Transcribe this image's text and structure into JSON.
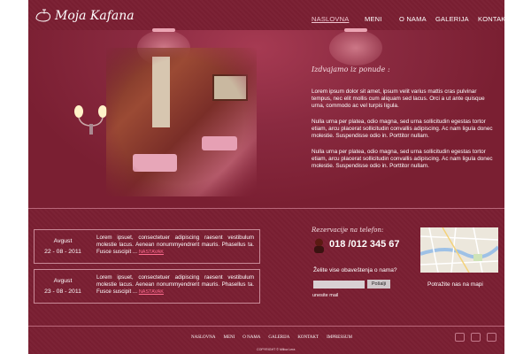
{
  "brand": {
    "logo_text": "Moja Kafana"
  },
  "nav": {
    "items": [
      {
        "label": "NASLOVNA",
        "active": true
      },
      {
        "label": "MENI",
        "active": false
      },
      {
        "label": "O NAMA",
        "active": false
      },
      {
        "label": "GALERIJA",
        "active": false
      },
      {
        "label": "KONTAKT",
        "active": false
      }
    ]
  },
  "hero": {
    "title": "Izdvajamo iz  ponude :",
    "paragraphs": [
      "Lorem ipsum dolor sit amet, ipsum velit varius mattis cras pulvinar tempus, nec elit mollis cum aliquam sed lacus. Orci a ut ante quisque urna, commodo ac vel turpis ligula.",
      "Nulla urna per platea, odio magna, sed urna sollicitudin egestas tortor etiam, arcu placerat sollicitudin convallis adipiscing. Ac nam ligula donec molestie. Suspendisse odio in. Porttitor nullam.",
      "Nulla urna per platea, odio magna, sed urna sollicitudin egestas tortor etiam, arcu placerat sollicitudin convallis adipiscing. Ac nam ligula donec molestie. Suspendisse odio in. Porttitor nullam."
    ]
  },
  "news": [
    {
      "label": "Avgust",
      "date": "22 - 08 - 2011",
      "text": "Lorem ipsuet, consectetuer adipiscing raesent vestibulum molestie lacus. Aenean nonummyendrerit mauris. Phasellus ta. Fusce suscipit ...",
      "more": "NASTAVAK"
    },
    {
      "label": "Avgust",
      "date": "23 - 08 - 2011",
      "text": "Lorem ipsuet, consectetuer adipiscing raesent vestibulum molestie lacus. Aenean nonummyendrerit mauris. Phasellus ta. Fusce suscipit ...",
      "more": "NASTAVAK"
    }
  ],
  "reservation": {
    "title": "Rezervacije na telefon:",
    "phone": "018 /012 345 67"
  },
  "newsletter": {
    "label": "Želite vise obaveštenja o nama?",
    "input_value": "",
    "button_label": "Pošalji",
    "hint": "unesite mail"
  },
  "map": {
    "caption": "Potražite nas na mapi"
  },
  "footer": {
    "nav": [
      "NASLOVNA",
      "MENI",
      "O NAMA",
      "GALERIJA",
      "KONTAKT",
      "IMPRESSUM"
    ],
    "copyright": "COPYRIGHT © Milica Lera"
  },
  "colors": {
    "background": "#7a1f32",
    "active_nav": "#f0c6d0",
    "more_link": "#ff6b8f"
  }
}
